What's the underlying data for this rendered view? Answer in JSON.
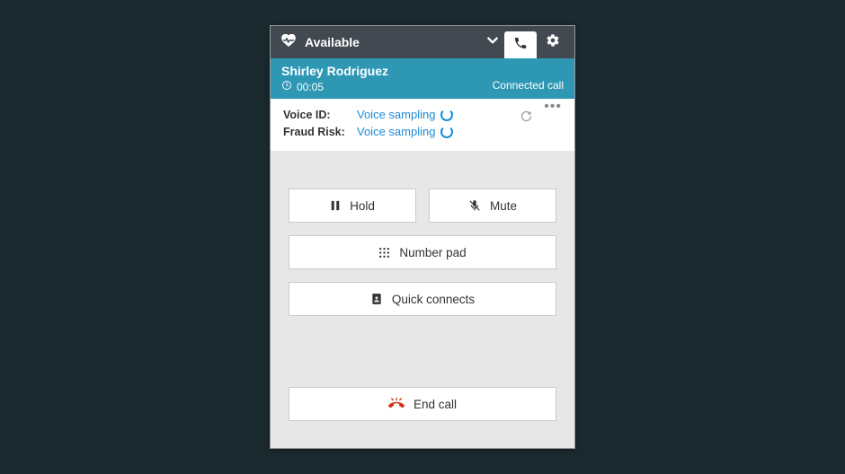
{
  "header": {
    "status": "Available"
  },
  "caller": {
    "name": "Shirley Rodriguez",
    "timer": "00:05",
    "state": "Connected call"
  },
  "voiceid": {
    "label1": "Voice ID:",
    "value1": "Voice sampling",
    "label2": "Fraud Risk:",
    "value2": "Voice sampling"
  },
  "buttons": {
    "hold": "Hold",
    "mute": "Mute",
    "numberpad": "Number pad",
    "quickconnects": "Quick connects",
    "endcall": "End call"
  }
}
